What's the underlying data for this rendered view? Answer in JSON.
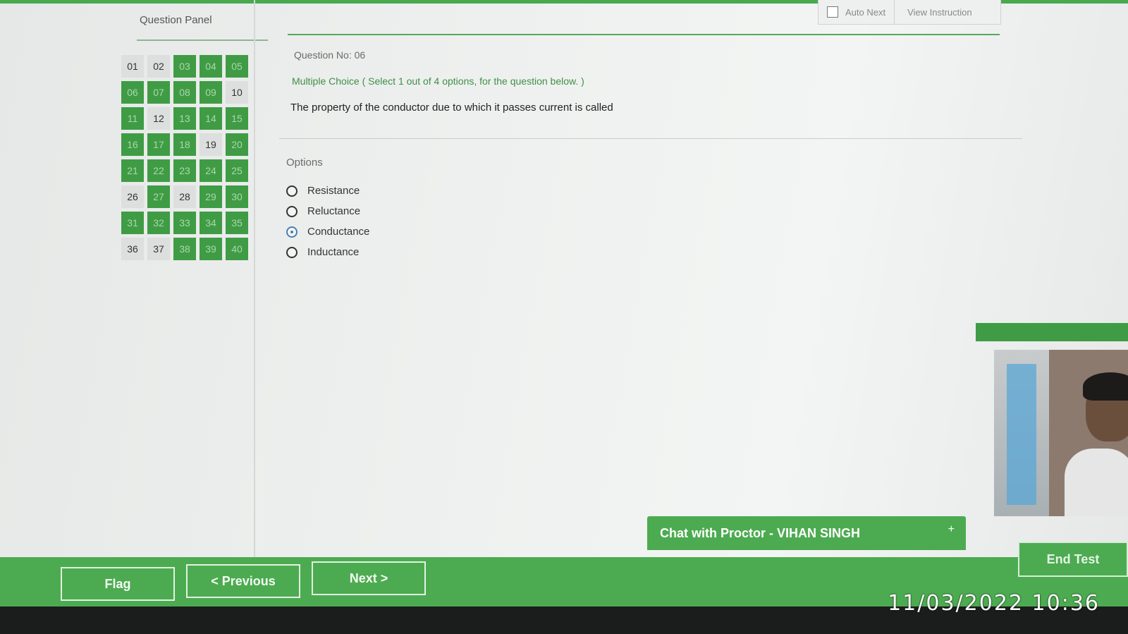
{
  "panel": {
    "title": "Question Panel",
    "questions": [
      {
        "num": "01",
        "answered": false
      },
      {
        "num": "02",
        "answered": false
      },
      {
        "num": "03",
        "answered": true
      },
      {
        "num": "04",
        "answered": true
      },
      {
        "num": "05",
        "answered": true
      },
      {
        "num": "06",
        "answered": true
      },
      {
        "num": "07",
        "answered": true
      },
      {
        "num": "08",
        "answered": true
      },
      {
        "num": "09",
        "answered": true
      },
      {
        "num": "10",
        "answered": false
      },
      {
        "num": "11",
        "answered": true
      },
      {
        "num": "12",
        "answered": false
      },
      {
        "num": "13",
        "answered": true
      },
      {
        "num": "14",
        "answered": true
      },
      {
        "num": "15",
        "answered": true
      },
      {
        "num": "16",
        "answered": true
      },
      {
        "num": "17",
        "answered": true
      },
      {
        "num": "18",
        "answered": true
      },
      {
        "num": "19",
        "answered": false
      },
      {
        "num": "20",
        "answered": true
      },
      {
        "num": "21",
        "answered": true
      },
      {
        "num": "22",
        "answered": true
      },
      {
        "num": "23",
        "answered": true
      },
      {
        "num": "24",
        "answered": true
      },
      {
        "num": "25",
        "answered": true
      },
      {
        "num": "26",
        "answered": false
      },
      {
        "num": "27",
        "answered": true
      },
      {
        "num": "28",
        "answered": false
      },
      {
        "num": "29",
        "answered": true
      },
      {
        "num": "30",
        "answered": true
      },
      {
        "num": "31",
        "answered": true
      },
      {
        "num": "32",
        "answered": true
      },
      {
        "num": "33",
        "answered": true
      },
      {
        "num": "34",
        "answered": true
      },
      {
        "num": "35",
        "answered": true
      },
      {
        "num": "36",
        "answered": false
      },
      {
        "num": "37",
        "answered": false
      },
      {
        "num": "38",
        "answered": true
      },
      {
        "num": "39",
        "answered": true
      },
      {
        "num": "40",
        "answered": true
      }
    ]
  },
  "question": {
    "number_label": "Question No: 06",
    "type_label": "Multiple Choice ( Select 1 out of 4 options, for the question below. )",
    "text": "The property of the conductor due to which it passes current is called",
    "options_label": "Options",
    "options": [
      {
        "label": "Resistance",
        "selected": false
      },
      {
        "label": "Reluctance",
        "selected": false
      },
      {
        "label": "Conductance",
        "selected": true
      },
      {
        "label": "Inductance",
        "selected": false
      }
    ]
  },
  "top_controls": {
    "auto_next_label": "Auto Next",
    "view_instruction_label": "View Instruction"
  },
  "footer": {
    "flag_label": "Flag",
    "previous_label": "< Previous",
    "next_label": "Next >",
    "end_test_label": "End Test",
    "chat_label": "Chat with Proctor - VIHAN SINGH",
    "chat_plus": "+"
  },
  "timestamp": "11/03/2022 10:36",
  "colors": {
    "accent_green": "#4cab50",
    "answered_cell": "#3f9c45",
    "selected_radio": "#4a7fb3"
  }
}
